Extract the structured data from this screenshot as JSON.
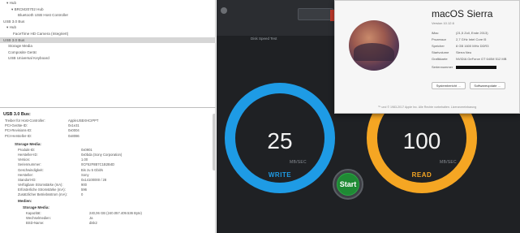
{
  "system_info": {
    "tree": [
      {
        "label": "▾ Hub",
        "indent": 8
      },
      {
        "label": "▾ BRCM20702 Hub",
        "indent": 14
      },
      {
        "label": "Bluetooth USB Host Controller",
        "indent": 22
      },
      {
        "label": "USB 3.0 Bus",
        "indent": 4
      },
      {
        "label": "▾ Hub",
        "indent": 8
      },
      {
        "label": "FaceTime HD Camera (Integriert)",
        "indent": 16
      },
      {
        "label": "USB 3.0 Bus",
        "indent": 4,
        "selected": true
      },
      {
        "label": "Storage Media",
        "indent": 10
      },
      {
        "label": "Composite Gerät",
        "indent": 10
      },
      {
        "label": "USB Universal Keyboard",
        "indent": 10
      }
    ],
    "detail_title": "USB 3.0 Bus:",
    "bus_rows": [
      {
        "k": "Treiber für Host-Controller:",
        "v": "AppleUSBXHCIPPT"
      },
      {
        "k": "PCI-Geräte-ID:",
        "v": "0x1e31"
      },
      {
        "k": "PCI-Revisions-ID:",
        "v": "0x0004"
      },
      {
        "k": "PCI-Hersteller-ID:",
        "v": "0x8086"
      }
    ],
    "device_title": "Storage Media:",
    "device_rows": [
      {
        "k": "Produkt-ID:",
        "v": "0x0901"
      },
      {
        "k": "Hersteller-ID:",
        "v": "0x0bda  (Sony Corporation)"
      },
      {
        "k": "Version:",
        "v": "1.00"
      },
      {
        "k": "Seriennummer:",
        "v": "0CF52F8B7C1B2B4D"
      },
      {
        "k": "Geschwindigkeit:",
        "v": "Bis zu 5 Gbit/s"
      },
      {
        "k": "Hersteller:",
        "v": "Sony"
      },
      {
        "k": "Standort-ID:",
        "v": "0x14100000 / 28"
      },
      {
        "k": "Verfügbare Stromstärke (mA):",
        "v": "900"
      },
      {
        "k": "Erforderliche Stromstärke (mA):",
        "v": "596"
      },
      {
        "k": "Zusätzlicher Betriebsstrom (mA):",
        "v": "0"
      }
    ],
    "media_title": "Medien:",
    "sub_media_title": "Storage Media:",
    "media_rows": [
      {
        "k": "Kapazität:",
        "v": "240,06 GB (240.057.409.536 Byte)"
      },
      {
        "k": "Wechselmedien:",
        "v": "Ja"
      },
      {
        "k": "BSD-Name:",
        "v": "disk2"
      }
    ]
  },
  "disk_speed_test": {
    "settings_label": "Disk Speed Test",
    "write": {
      "value": "25",
      "unit": "MB/SEC",
      "label": "WRITE",
      "color": "#1e9be5"
    },
    "read": {
      "value": "100",
      "unit": "MB/SEC",
      "label": "READ",
      "color": "#f5a623"
    },
    "start_label": "Start",
    "start_color": "#1f8a34"
  },
  "about_mac": {
    "os_name_light": "macOS",
    "os_name_bold": "Sierra",
    "version": "Version 10.12.6",
    "specs": [
      {
        "k": "iMac",
        "v": "(21,5 Zoll, Ende 2013)"
      },
      {
        "k": "Prozessor",
        "v": "2,7 GHz Intel Core i5"
      },
      {
        "k": "Speicher",
        "v": "8 GB 1600 MHz DDR3"
      },
      {
        "k": "Startvolume",
        "v": "Sierra Neu"
      },
      {
        "k": "Grafikkarte",
        "v": "NVIDIA GeForce GT 640M 512 MB"
      },
      {
        "k": "Seriennummer",
        "v": ""
      }
    ],
    "buttons": [
      "Systembericht …",
      "Softwareupdate …"
    ],
    "footer": "™ und © 1983-2017 Apple Inc. Alle Rechte vorbehalten.  Lizenzvereinbarung"
  }
}
